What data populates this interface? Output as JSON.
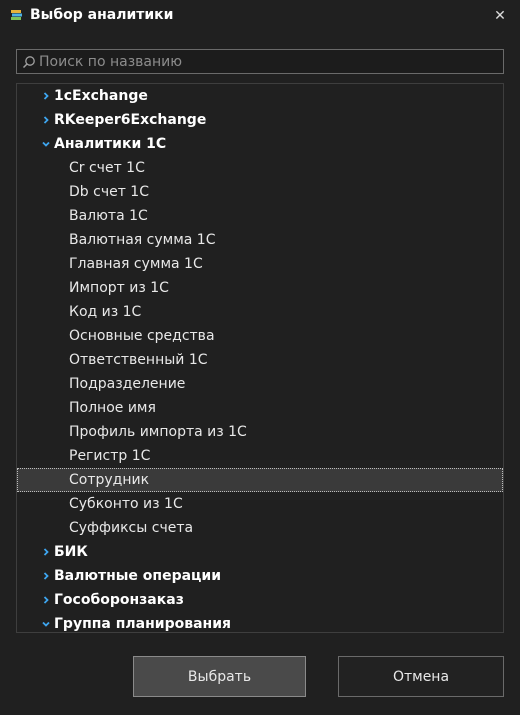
{
  "window": {
    "title": "Выбор аналитики",
    "close_label": "✕"
  },
  "search": {
    "placeholder": "Поиск по названию",
    "value": ""
  },
  "tree": {
    "items": [
      {
        "label": "1cExchange",
        "level": 0,
        "expanded": false
      },
      {
        "label": "RKeeper6Exchange",
        "level": 0,
        "expanded": false
      },
      {
        "label": "Аналитики 1С",
        "level": 0,
        "expanded": true
      },
      {
        "label": "Cr счет 1C",
        "level": 1
      },
      {
        "label": "Db счет 1C",
        "level": 1
      },
      {
        "label": "Валюта 1С",
        "level": 1
      },
      {
        "label": "Валютная сумма 1С",
        "level": 1
      },
      {
        "label": "Главная сумма 1С",
        "level": 1
      },
      {
        "label": "Импорт из 1С",
        "level": 1
      },
      {
        "label": "Код из 1С",
        "level": 1
      },
      {
        "label": "Основные средства",
        "level": 1
      },
      {
        "label": "Ответственный 1С",
        "level": 1
      },
      {
        "label": "Подразделение",
        "level": 1
      },
      {
        "label": "Полное имя",
        "level": 1
      },
      {
        "label": "Профиль импорта из 1С",
        "level": 1
      },
      {
        "label": "Регистр 1С",
        "level": 1
      },
      {
        "label": "Сотрудник",
        "level": 1,
        "selected": true
      },
      {
        "label": "Субконто из 1С",
        "level": 1
      },
      {
        "label": "Суффиксы счета",
        "level": 1
      },
      {
        "label": "БИК",
        "level": 0,
        "expanded": false
      },
      {
        "label": "Валютные операции",
        "level": 0,
        "expanded": false
      },
      {
        "label": "Гособоронзаказ",
        "level": 0,
        "expanded": false
      },
      {
        "label": "Группа планирования",
        "level": 0,
        "expanded": true
      }
    ]
  },
  "buttons": {
    "ok_label": "Выбрать",
    "cancel_label": "Отмена"
  },
  "colors": {
    "accent": "#3ea6f0",
    "background": "#202020",
    "selected_row": "#3a3a3a"
  }
}
